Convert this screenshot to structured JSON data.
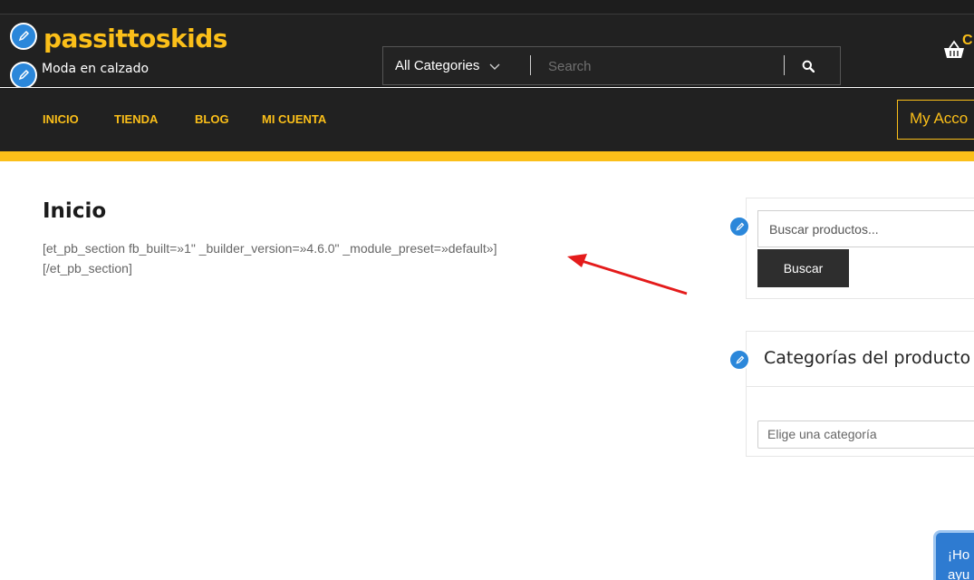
{
  "site": {
    "logo_text": "passittoskids",
    "tagline": "Moda en calzado"
  },
  "search": {
    "category_selected": "All Categories",
    "placeholder": "Search"
  },
  "cart": {
    "badge_text": "C"
  },
  "nav": {
    "items": [
      {
        "label": "INICIO"
      },
      {
        "label": "TIENDA"
      },
      {
        "label": "BLOG"
      },
      {
        "label": "MI CUENTA"
      }
    ],
    "account_label": "My Acco"
  },
  "main": {
    "title": "Inicio",
    "shortcode_line1": "[et_pb_section fb_built=»1\" _builder_version=»4.6.0\" _module_preset=»default»]",
    "shortcode_line2": "[/et_pb_section]"
  },
  "sidebar": {
    "product_search": {
      "placeholder": "Buscar productos...",
      "button_label": "Buscar"
    },
    "categories": {
      "title": "Categorías del producto",
      "dropdown_value": "Elige una categoría"
    }
  },
  "chat": {
    "line1": "¡Ho",
    "line2": "ayu"
  },
  "colors": {
    "accent": "#fbbf19",
    "header_bg": "#212121",
    "edit_icon": "#2b87da",
    "arrow": "#e41b1b"
  }
}
